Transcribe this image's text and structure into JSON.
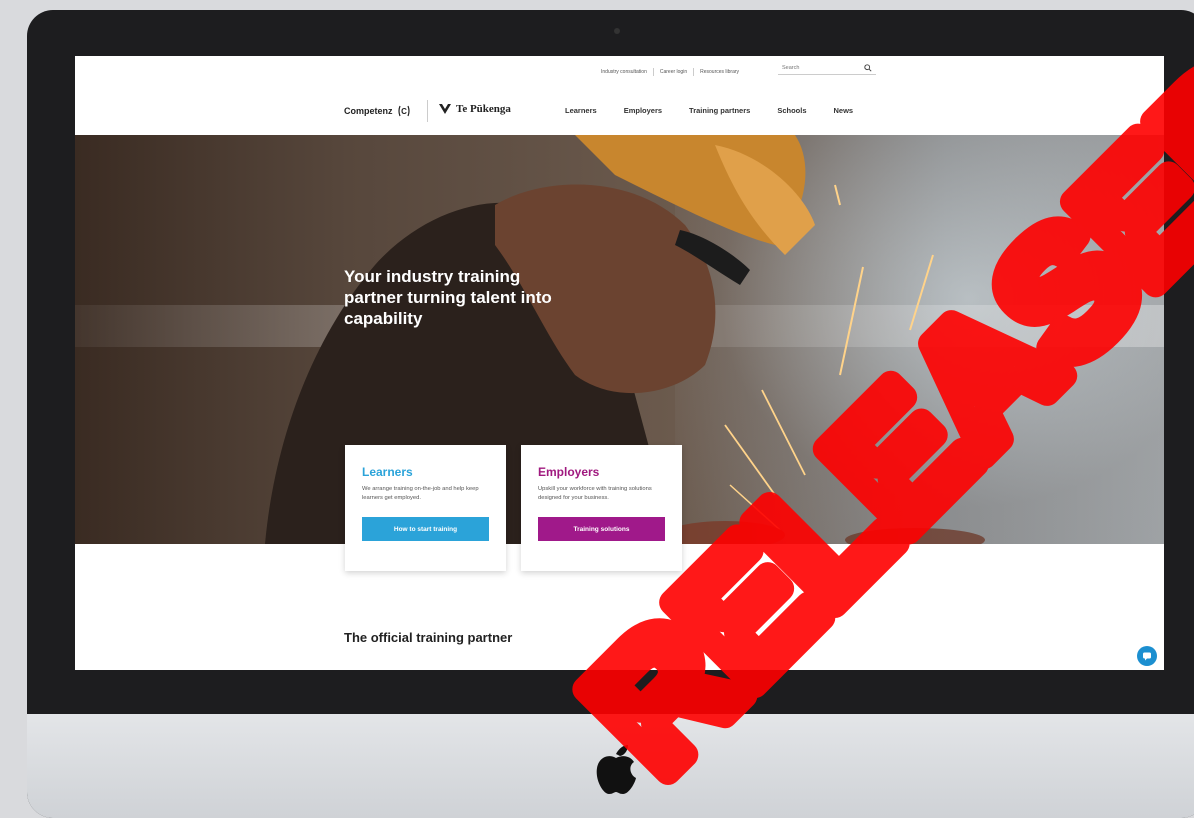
{
  "utility_nav": [
    "Industry consultation",
    "Career login",
    "Resources library"
  ],
  "search": {
    "placeholder": "Search"
  },
  "brand": {
    "competenz": "Competenz",
    "te_pukenga": "Te Pūkenga"
  },
  "main_nav": [
    "Learners",
    "Employers",
    "Training partners",
    "Schools",
    "News"
  ],
  "hero": {
    "headline": "Your industry training partner turning talent into capability"
  },
  "cards": [
    {
      "title": "Learners",
      "text": "We arrange training on-the-job and help keep learners get employed.",
      "button": "How to start training"
    },
    {
      "title": "Employers",
      "text": "Upskill your workforce with training solutions designed for your business.",
      "button": "Training solutions"
    }
  ],
  "section_heading": "The official training partner",
  "colors": {
    "learners_accent": "#2ba3d9",
    "employers_accent": "#a0198a",
    "watermark": "#ff0000"
  },
  "watermark_text": "RELEASED UNDER THE OFFICIAL INFORMATION ACT"
}
